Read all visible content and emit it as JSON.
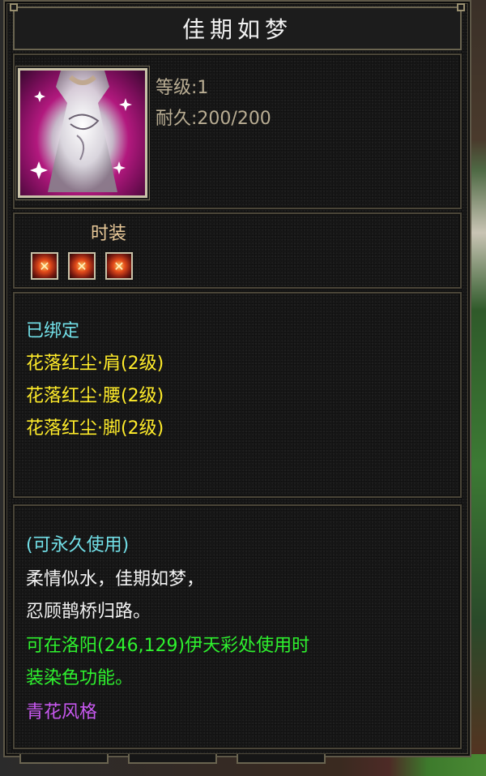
{
  "item": {
    "name": "佳期如梦",
    "level": "等级:1",
    "durability": "耐久:200/200",
    "category": "时装",
    "socket_icons": [
      "gem-slot-icon",
      "gem-slot-icon",
      "gem-slot-icon"
    ]
  },
  "bind_section": {
    "bound_status": "已绑定",
    "set_pieces": [
      "花落红尘·肩(2级)",
      "花落红尘·腰(2级)",
      "花落红尘·脚(2级)"
    ]
  },
  "description": {
    "usage": "(可永久使用)",
    "flavor_lines": [
      "柔情似水，佳期如梦，",
      "忍顾鹊桥归路。"
    ],
    "dye_lines": [
      "可在洛阳(246,129)伊天彩处使用时",
      "装染色功能。"
    ],
    "style": "青花风格"
  },
  "colors": {
    "bound": "#72e0e8",
    "set": "#ffec2a",
    "flavor": "#f2f2f2",
    "dye": "#2ef22e",
    "style": "#c858f0",
    "stat": "#b9ad93",
    "category": "#e8c898"
  }
}
